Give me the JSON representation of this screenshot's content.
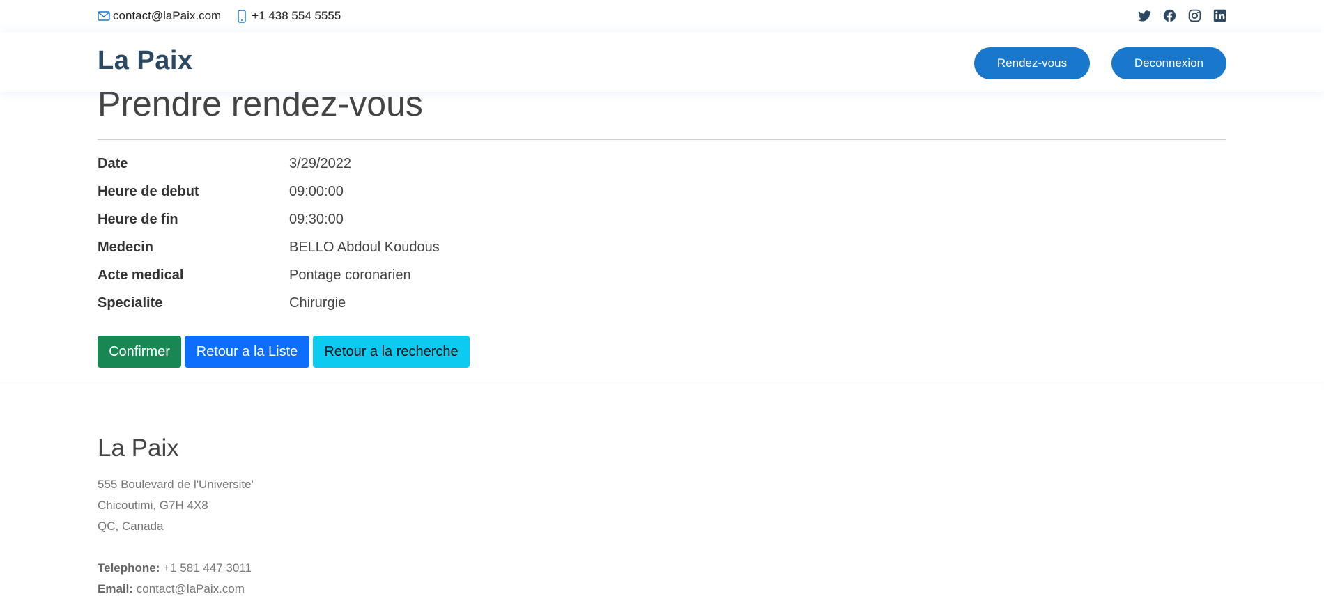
{
  "topbar": {
    "email": "contact@laPaix.com",
    "phone": "+1 438 554 5555",
    "social": [
      "twitter-icon",
      "facebook-icon",
      "instagram-icon",
      "linkedin-icon"
    ]
  },
  "header": {
    "logo": "La Paix",
    "nav": {
      "rdv_label": "Rendez-vous",
      "logout_label": "Deconnexion"
    }
  },
  "main": {
    "title": "Prendre rendez-vous",
    "details": [
      {
        "label": "Date",
        "value": "3/29/2022"
      },
      {
        "label": "Heure de debut",
        "value": "09:00:00"
      },
      {
        "label": "Heure de fin",
        "value": "09:30:00"
      },
      {
        "label": "Medecin",
        "value": "BELLO Abdoul Koudous"
      },
      {
        "label": "Acte medical",
        "value": "Pontage coronarien"
      },
      {
        "label": "Specialite",
        "value": "Chirurgie"
      }
    ],
    "actions": {
      "confirm": "Confirmer",
      "back_list": "Retour a la Liste",
      "back_search": "Retour a la recherche"
    }
  },
  "footer": {
    "title": "La Paix",
    "address": [
      "555 Boulevard de l'Universite'",
      "Chicoutimi, G7H 4X8",
      "QC, Canada"
    ],
    "phone_label": "Telephone:",
    "phone": "+1 581 447 3011",
    "email_label": "Email:",
    "email": "contact@laPaix.com"
  },
  "colors": {
    "primary": "#1977cc",
    "logo": "#2c4964",
    "confirm": "#198754",
    "list": "#0d6efd",
    "search": "#0dcaf0"
  }
}
